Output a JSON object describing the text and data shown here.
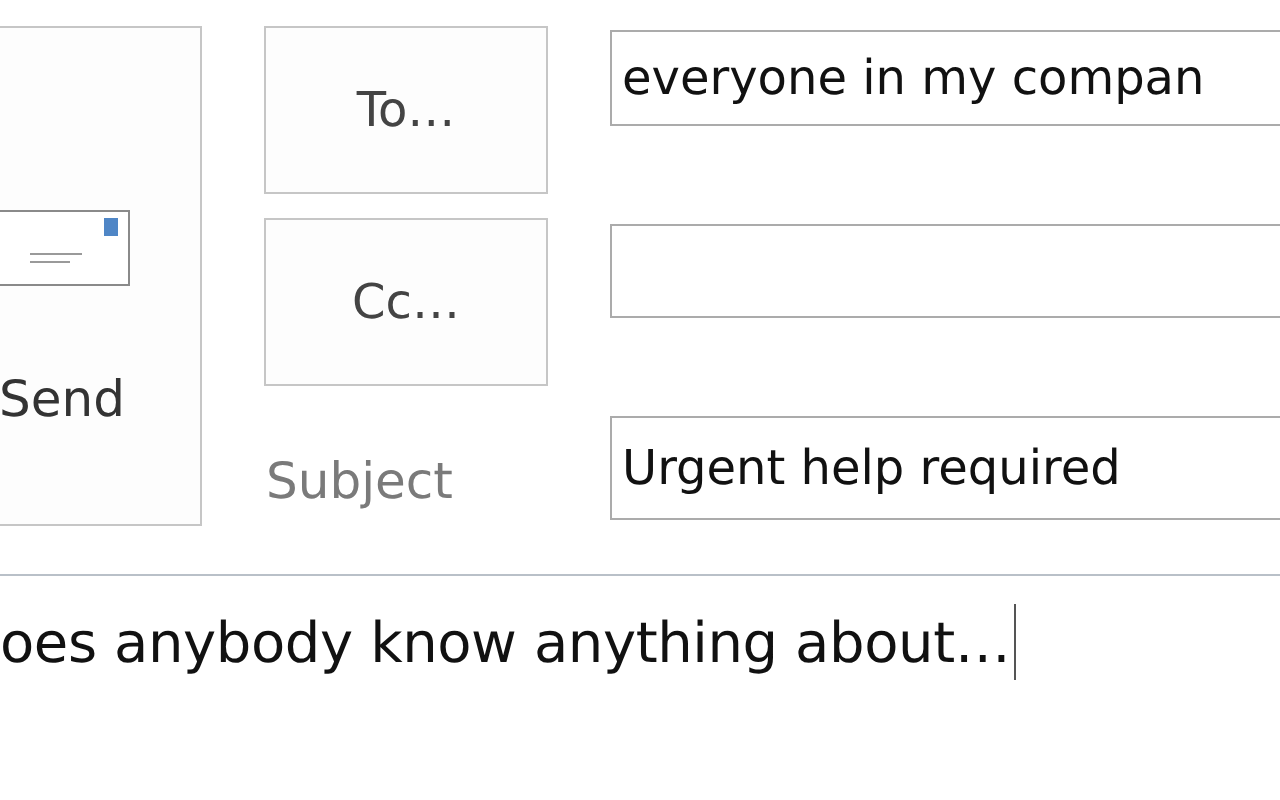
{
  "send_button": {
    "label": "Send"
  },
  "recipients": [
    {
      "button": "To…",
      "value": "everyone in my compan"
    },
    {
      "button": "Cc…"
    }
  ],
  "subject": {
    "label": "Subject",
    "value": "Urgent help required"
  },
  "body": {
    "text": "oes anybody know anything about…",
    "focused": true
  }
}
